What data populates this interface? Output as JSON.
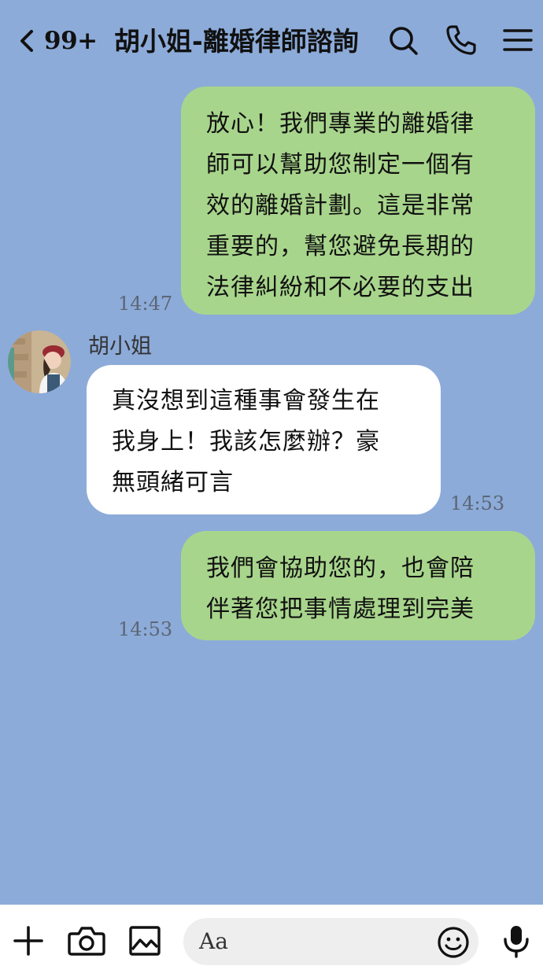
{
  "header": {
    "unread_count": "99+",
    "chat_title": "胡小姐-離婚律師諮詢"
  },
  "messages": [
    {
      "direction": "out",
      "text": "放心！我們專業的離婚律\n師可以幫助您制定一個有\n效的離婚計劃。這是非常\n重要的，幫您避免長期的\n法律糾紛和不必要的支出",
      "time": "14:47"
    },
    {
      "direction": "in",
      "sender": "胡小姐",
      "text": "真沒想到這種事會發生在\n我身上！我該怎麼辦？豪\n無頭緒可言",
      "time": "14:53"
    },
    {
      "direction": "out",
      "text": "我們會協助您的，也會陪\n伴著您把事情處理到完美",
      "time": "14:53"
    }
  ],
  "composer": {
    "placeholder": "Aa"
  },
  "colors": {
    "background": "#8cabd9",
    "outgoing_bubble": "#a8d58c",
    "incoming_bubble": "#ffffff"
  }
}
